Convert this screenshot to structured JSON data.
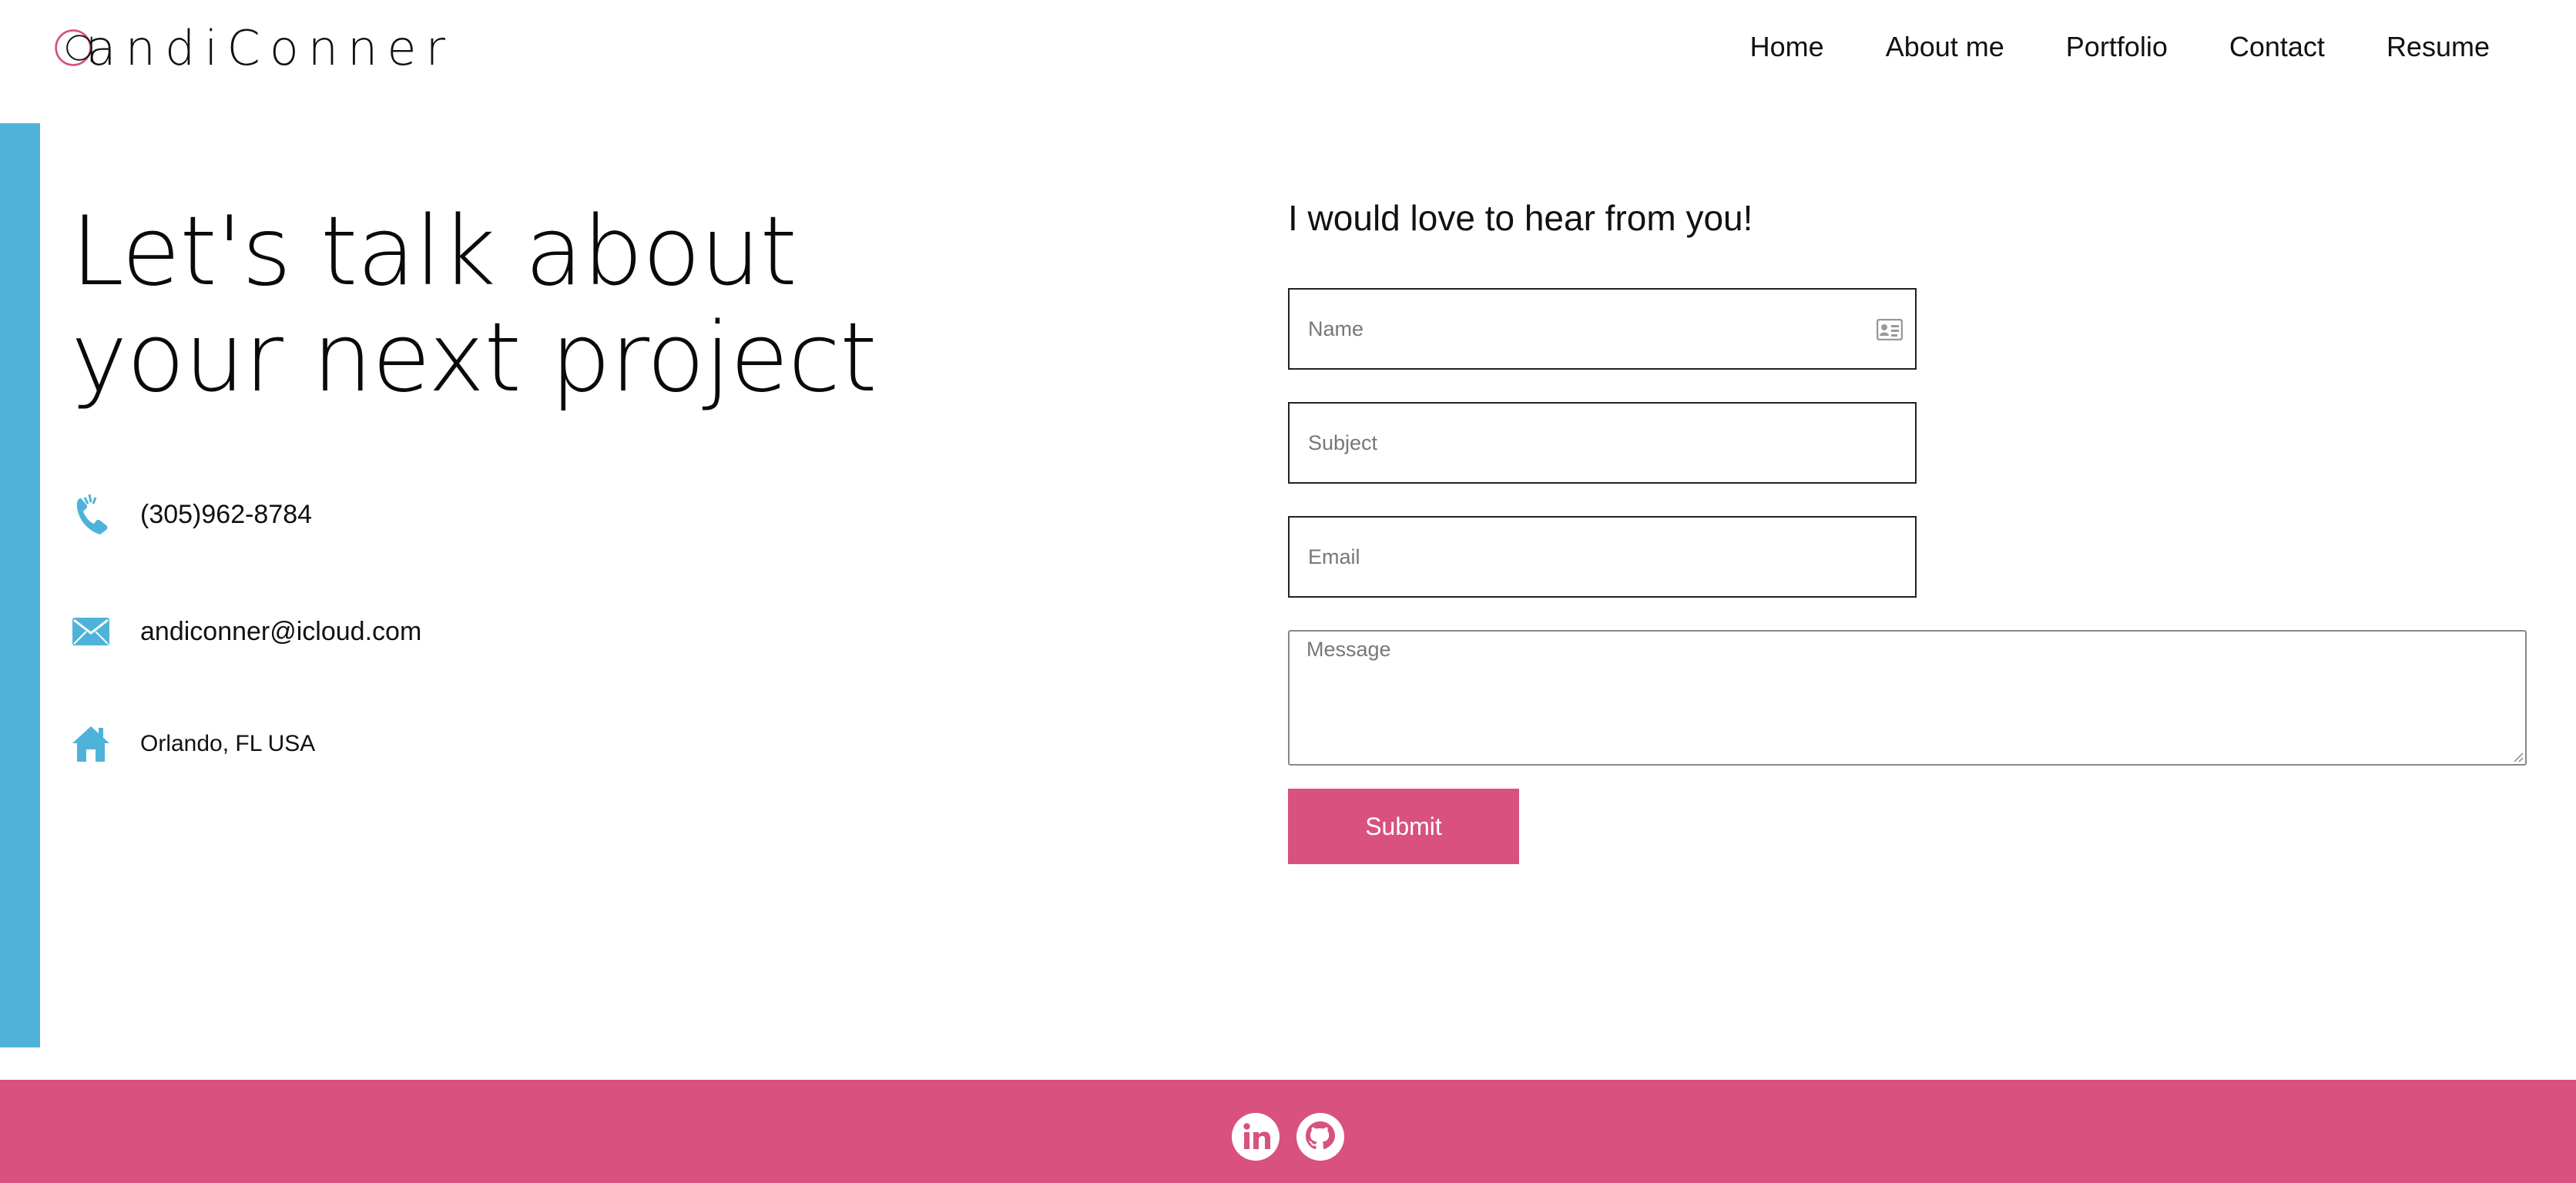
{
  "header": {
    "logo_text": "andiConner",
    "nav": [
      "Home",
      "About me",
      "Portfolio",
      "Contact",
      "Resume"
    ]
  },
  "hero": {
    "headline_line1": "Let's talk about",
    "headline_line2": "your next project"
  },
  "contact": {
    "phone": "(305)962-8784",
    "email": "andiconner@icloud.com",
    "location": "Orlando, FL USA"
  },
  "form": {
    "title": "I would love to hear from you!",
    "name_placeholder": "Name",
    "subject_placeholder": "Subject",
    "email_placeholder": "Email",
    "message_placeholder": "Message",
    "submit_label": "Submit"
  },
  "footer": {
    "social": [
      "linkedin-icon",
      "github-icon"
    ]
  },
  "colors": {
    "accent_blue": "#4fb3d9",
    "brand_pink": "#d8517f"
  }
}
